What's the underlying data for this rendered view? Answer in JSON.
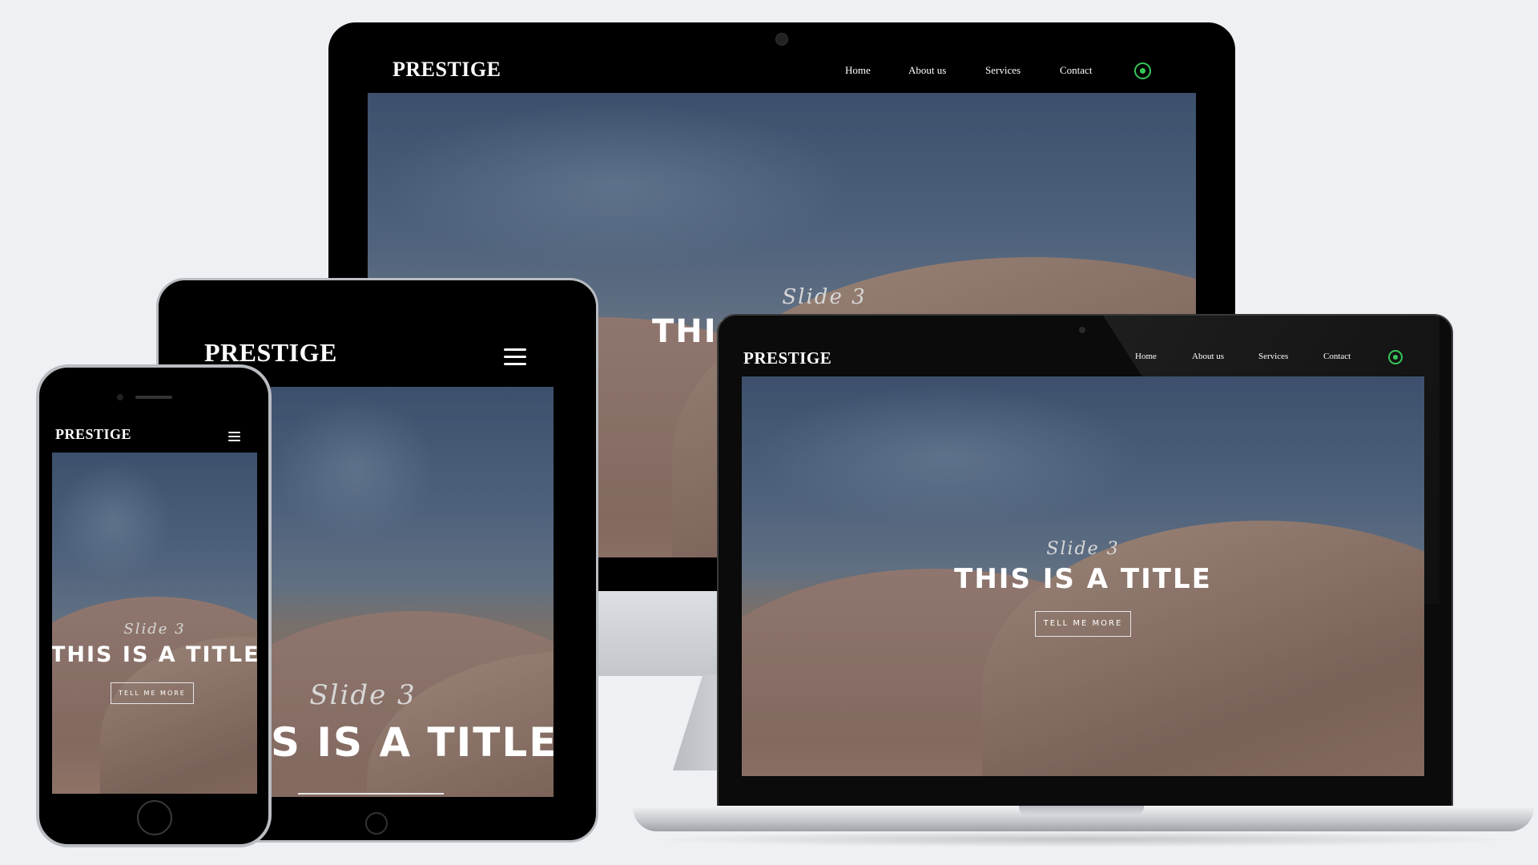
{
  "brand": "PRESTIGE",
  "nav": {
    "home": "Home",
    "about": "About us",
    "services": "Services",
    "contact": "Contact"
  },
  "hero": {
    "slide": "Slide 3",
    "title": "THIS IS A TITLE",
    "button": "TELL ME MORE"
  },
  "tablet_hero": {
    "title_visible": "S IS A TITLE"
  },
  "desktop_hero": {
    "title_visible": "THIS"
  },
  "icons": {
    "whatsapp": "whatsapp-icon",
    "menu": "hamburger-menu-icon"
  },
  "colors": {
    "whatsapp": "#34c759",
    "frame": "#0a0a0a",
    "silver": "#c9ccd1"
  }
}
